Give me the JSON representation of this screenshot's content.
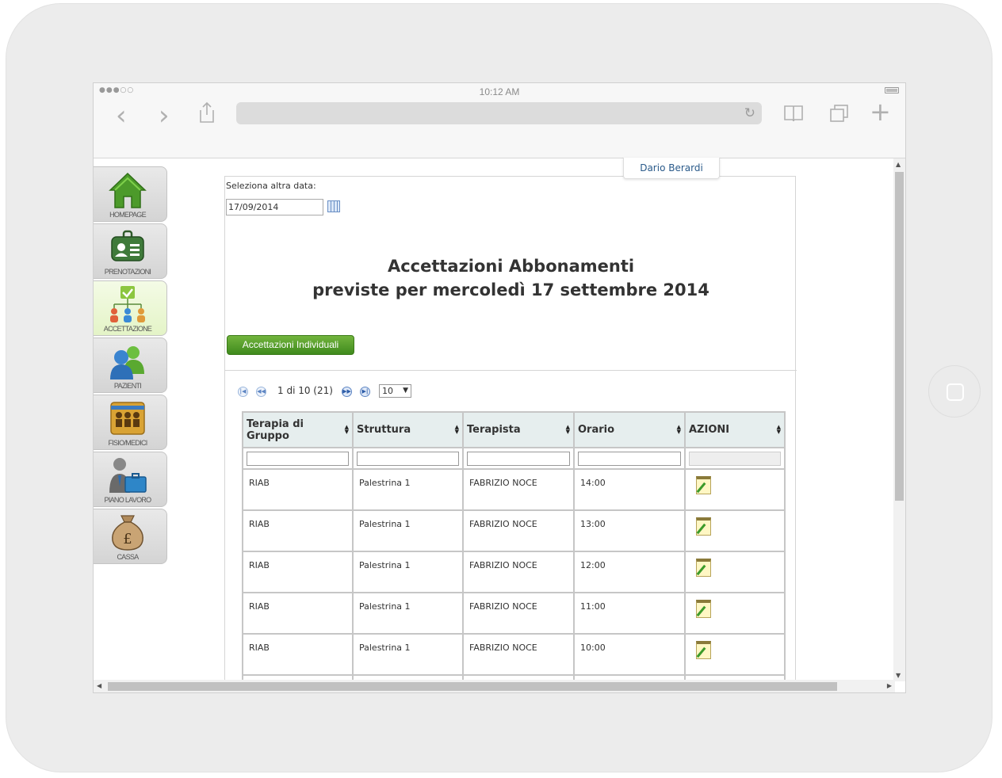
{
  "device": {
    "clock": "10:12 AM",
    "signal": "●●●○○"
  },
  "browser": {
    "back": "‹",
    "forward": "›",
    "reload": "↻",
    "new_tab": "+"
  },
  "user": {
    "name": "Dario Berardi"
  },
  "sidebar": {
    "items": [
      {
        "label": "HOMEPAGE",
        "icon": "house-icon"
      },
      {
        "label": "PRENOTAZIONI",
        "icon": "badge-icon"
      },
      {
        "label": "ACCETTAZIONE",
        "icon": "org-chart-icon",
        "active": true
      },
      {
        "label": "PAZIENTI",
        "icon": "people-icon"
      },
      {
        "label": "FISIO/MEDICI",
        "icon": "team-board-icon"
      },
      {
        "label": "PIANO LAVORO",
        "icon": "worker-briefcase-icon"
      },
      {
        "label": "CASSA",
        "icon": "money-bag-icon"
      }
    ]
  },
  "filter": {
    "label": "Seleziona altra data:",
    "date_value": "17/09/2014"
  },
  "page": {
    "title_line1": "Accettazioni Abbonamenti",
    "title_line2": "previste per mercoledì 17 settembre 2014",
    "button_label": "Accettazioni Individuali"
  },
  "pager": {
    "first": "|◀",
    "prev": "◀◀",
    "next": "▶▶",
    "last": "▶|",
    "text": "1 di 10 (21)",
    "page_size": "10"
  },
  "table": {
    "headers": [
      "Terapia di Gruppo",
      "Struttura",
      "Terapista",
      "Orario",
      "AZIONI"
    ],
    "rows": [
      [
        "RIAB",
        "Palestrina 1",
        "FABRIZIO NOCE",
        "14:00"
      ],
      [
        "RIAB",
        "Palestrina 1",
        "FABRIZIO NOCE",
        "13:00"
      ],
      [
        "RIAB",
        "Palestrina 1",
        "FABRIZIO NOCE",
        "12:00"
      ],
      [
        "RIAB",
        "Palestrina 1",
        "FABRIZIO NOCE",
        "11:00"
      ],
      [
        "RIAB",
        "Palestrina 1",
        "FABRIZIO NOCE",
        "10:00"
      ]
    ]
  },
  "colors": {
    "accent_green": "#4e9a26",
    "header_bg": "#e6eeee",
    "active_nav": "#e4f4c7"
  }
}
